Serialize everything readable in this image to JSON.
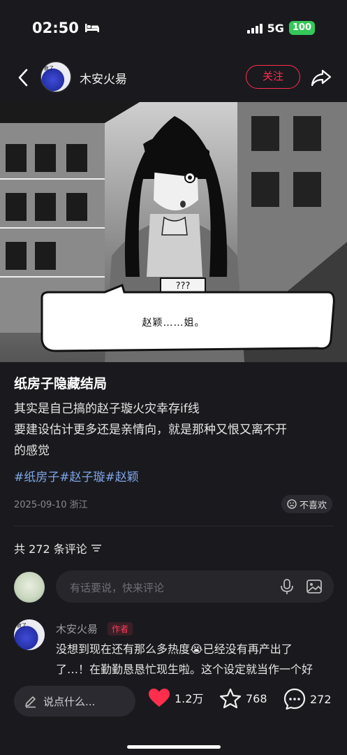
{
  "status": {
    "time": "02:50",
    "network": "5G",
    "battery": "100"
  },
  "nav": {
    "author": "木安火昜",
    "follow_label": "关注"
  },
  "hero": {
    "caption": "赵颖……姐。",
    "question": "???"
  },
  "post": {
    "title": "纸房子隐藏结局",
    "body_lines": [
      "其实是自己搞的赵子璇火灾幸存if线",
      "要建设估计更多还是亲情向，就是那种又恨又离不开",
      "的感觉"
    ],
    "tags": [
      "#纸房子",
      "#赵子璇",
      "#赵颖"
    ],
    "date": "2025-09-10 浙江",
    "dislike_label": "不喜欢"
  },
  "comments": {
    "count_label": "共 272 条评论",
    "input_placeholder": "有话要说，快来评论",
    "items": [
      {
        "name": "木安火昜",
        "badge": "作者",
        "text_line1": "没想到现在还有那么多热度",
        "text_line1b": "已经没有再产出了",
        "text_line2": "了…！在勤勤恳恳忙现生啦。这个设定就当作一个好"
      }
    ]
  },
  "bottom": {
    "say_label": "说点什么...",
    "likes": "1.2万",
    "stars": "768",
    "comments": "272"
  },
  "colors": {
    "accent": "#ff2e4d",
    "tag": "#7fa6e8",
    "battery": "#35c759"
  }
}
